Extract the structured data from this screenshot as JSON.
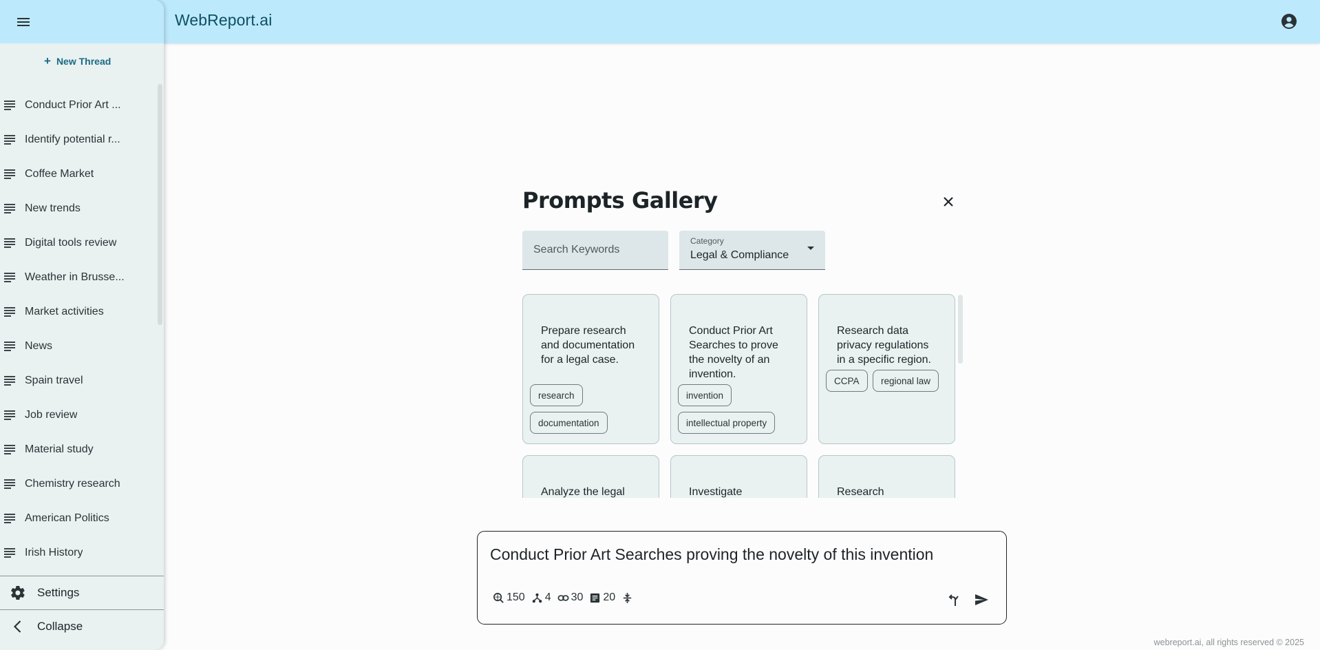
{
  "app": {
    "title": "WebReport.ai"
  },
  "sidebar": {
    "new_thread_label": "New Thread",
    "items": [
      {
        "label": "Conduct Prior Art ..."
      },
      {
        "label": "Identify potential r..."
      },
      {
        "label": "Coffee Market"
      },
      {
        "label": "New trends"
      },
      {
        "label": "Digital tools review"
      },
      {
        "label": "Weather in Brusse..."
      },
      {
        "label": "Market activities"
      },
      {
        "label": "News"
      },
      {
        "label": "Spain travel"
      },
      {
        "label": "Job review"
      },
      {
        "label": "Material study"
      },
      {
        "label": "Chemistry research"
      },
      {
        "label": "American Politics"
      },
      {
        "label": "Irish History"
      }
    ],
    "settings_label": "Settings",
    "collapse_label": "Collapse"
  },
  "gallery": {
    "title": "Prompts Gallery",
    "search_placeholder": "Search Keywords",
    "category_label": "Category",
    "category_value": "Legal & Compliance",
    "cards": [
      {
        "text": "Prepare research and documentation for a legal case.",
        "tags": [
          "research",
          "documentation"
        ]
      },
      {
        "text": "Conduct Prior Art Searches to prove the novelty of an invention.",
        "tags": [
          "invention",
          "intellectual property"
        ]
      },
      {
        "text": "Research data privacy regulations in a specific region.",
        "tags": [
          "CCPA",
          "regional law"
        ]
      },
      {
        "text": "Analyze the legal"
      },
      {
        "text": "Investigate"
      },
      {
        "text": "Research"
      }
    ]
  },
  "composer": {
    "query": "Conduct Prior Art Searches proving the novelty of this invention",
    "stats": {
      "searches": "150",
      "depth": "4",
      "links": "30",
      "pages": "20"
    }
  },
  "footer": {
    "copyright": "webreport.ai, all rights reserved © 2025"
  },
  "colors": {
    "topbar": "#bde9fc",
    "sidebar": "#e9f1f1",
    "brand": "#0f4f63",
    "accent": "#1a6a84"
  },
  "icons": [
    "menu-icon",
    "account-circle-icon",
    "plus-icon",
    "notes-icon",
    "gear-icon",
    "chevron-left-icon",
    "close-icon",
    "search-globe-icon",
    "fork-icon",
    "link-icon",
    "article-icon",
    "expand-vertical-icon",
    "branch-icon",
    "send-icon"
  ]
}
